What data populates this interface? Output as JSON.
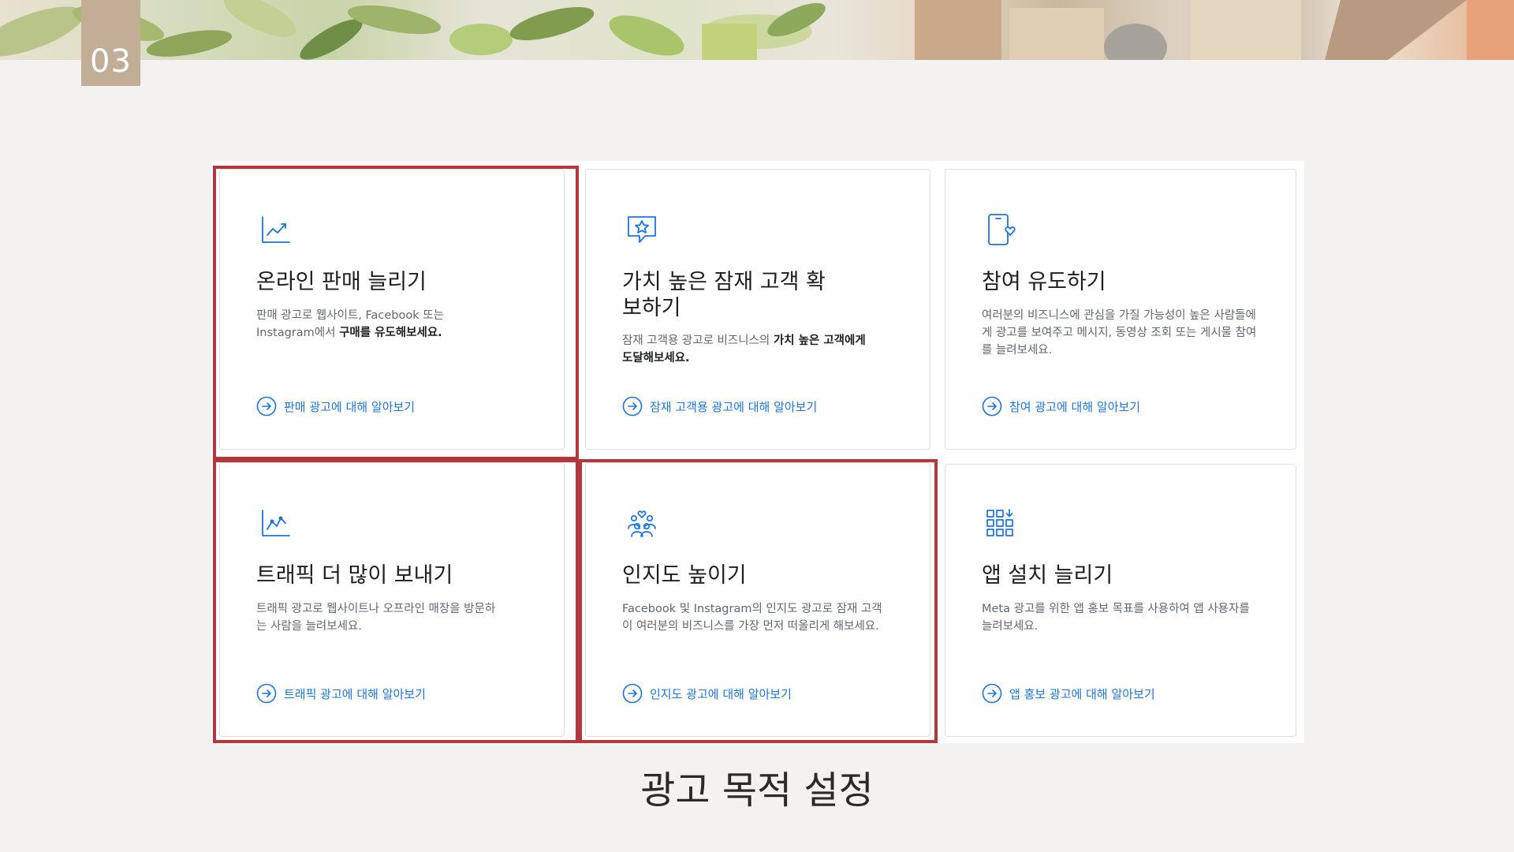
{
  "slide": {
    "number": "03",
    "caption": "광고 목적 설정"
  },
  "colors": {
    "highlight": "#b3383c",
    "link": "#1b74e4",
    "slide_badge": "#c2ad96"
  },
  "cards": [
    {
      "title": "온라인 판매 늘리기",
      "desc_a": "판매 광고로 웹사이트, Facebook 또는 Instagram에서 ",
      "desc_b": "구매를 유도해보세요.",
      "desc_c": "",
      "link": "판매 광고에 대해 알아보기",
      "icon": "line-chart-icon",
      "highlighted": true
    },
    {
      "title": "가치 높은 잠재 고객 확보하기",
      "desc_a": "잠재 고객용 광고로 비즈니스의 ",
      "desc_b": "가치 높은 고객에게 도달해보세요.",
      "desc_c": "",
      "link": "잠재 고객용 광고에 대해 알아보기",
      "icon": "star-speech-bubble-icon",
      "highlighted": false
    },
    {
      "title": "참여 유도하기",
      "desc_a": "여러분의 비즈니스에 관심을 가질 가능성이 높은 사람들에게 광고를 보여주고 메시지, 동영상 조회 또는 게시물 참여를 늘려보세요.",
      "desc_b": "",
      "desc_c": "",
      "link": "참여 광고에 대해 알아보기",
      "icon": "phone-heart-icon",
      "highlighted": false
    },
    {
      "title": "트래픽 더 많이 보내기",
      "desc_a": "트래픽 광고로 웹사이트나 오프라인 매장을 방문하는 사람을 늘려보세요.",
      "desc_b": "",
      "desc_c": "",
      "link": "트래픽 광고에 대해 알아보기",
      "icon": "traffic-chart-icon",
      "highlighted": true
    },
    {
      "title": "인지도 높이기",
      "desc_a": "Facebook 및 Instagram의 인지도 광고로 잠재 고객이 여러분의 비즈니스를 가장 먼저 떠올리게 해보세요.",
      "desc_b": "",
      "desc_c": "",
      "link": "인지도 광고에 대해 알아보기",
      "icon": "people-heart-icon",
      "highlighted": true
    },
    {
      "title": "앱 설치 늘리기",
      "desc_a": "Meta 광고를 위한 앱 홍보 목표를 사용하여 앱 사용자를 늘려보세요.",
      "desc_b": "",
      "desc_c": "",
      "link": "앱 홍보 광고에 대해 알아보기",
      "icon": "app-grid-download-icon",
      "highlighted": false
    }
  ]
}
